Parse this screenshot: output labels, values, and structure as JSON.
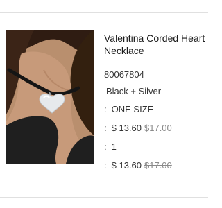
{
  "product": {
    "title": "Valentina Corded Heart Necklace",
    "sku": "80067804",
    "color": "Black + Silver",
    "size_label": "ONE SIZE",
    "price": "$ 13.60",
    "compare_price": "$17.00",
    "quantity": "1",
    "total_price": "$ 13.60",
    "total_compare_price": "$17.00",
    "separator": ":"
  },
  "image": {
    "icon": "product-photo",
    "description_colors": {
      "skin": "#c79a7a",
      "hair": "#3b2417",
      "top": "#1f1f1f",
      "cord": "#151515",
      "pendant": "#e6e9ec"
    }
  }
}
